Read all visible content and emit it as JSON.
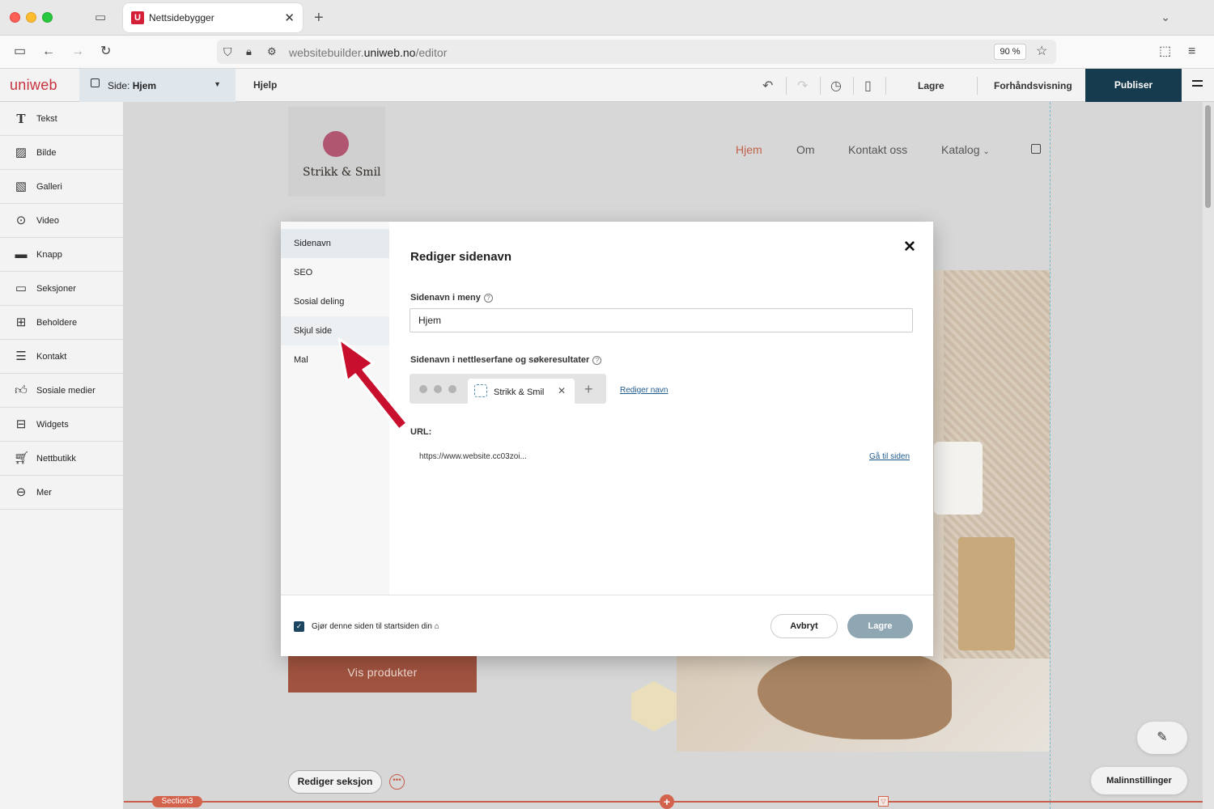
{
  "browser": {
    "tab_title": "Nettsidebygger",
    "tab_favicon": "U",
    "url_prefix": "websitebuilder.",
    "url_domain": "uniweb.no",
    "url_path": "/editor",
    "zoom": "90 %"
  },
  "editor": {
    "logo": "uniweb",
    "page_label": "Side:",
    "page_name": "Hjem",
    "help": "Hjelp",
    "save": "Lagre",
    "preview": "Forhåndsvisning",
    "publish": "Publiser",
    "publish_color": "#163a4e"
  },
  "sidebar": {
    "items": [
      {
        "label": "Tekst",
        "icon": "text-icon"
      },
      {
        "label": "Bilde",
        "icon": "image-icon"
      },
      {
        "label": "Galleri",
        "icon": "gallery-icon"
      },
      {
        "label": "Video",
        "icon": "video-icon"
      },
      {
        "label": "Knapp",
        "icon": "button-icon"
      },
      {
        "label": "Seksjoner",
        "icon": "sections-icon"
      },
      {
        "label": "Beholdere",
        "icon": "containers-icon"
      },
      {
        "label": "Kontakt",
        "icon": "contact-icon"
      },
      {
        "label": "Sosiale medier",
        "icon": "thumbs-up-icon"
      },
      {
        "label": "Widgets",
        "icon": "widgets-icon"
      },
      {
        "label": "Nettbutikk",
        "icon": "cart-icon"
      },
      {
        "label": "Mer",
        "icon": "more-icon"
      }
    ]
  },
  "site": {
    "name": "Strikk & Smil",
    "nav": [
      "Hjem",
      "Om",
      "Kontakt oss",
      "Katalog"
    ],
    "nav_active_color": "#c0614c",
    "cta": "Vis produkter",
    "edit_section": "Rediger seksjon",
    "section_tag": "Section3",
    "template_settings": "Malinnstillinger"
  },
  "modal": {
    "tabs": [
      "Sidenavn",
      "SEO",
      "Sosial deling",
      "Skjul side",
      "Mal"
    ],
    "title": "Rediger sidenavn",
    "menu_name_label": "Sidenavn i meny",
    "menu_name_value": "Hjem",
    "browser_name_label": "Sidenavn i nettleserfane og søkeresultater",
    "preview_tab_name": "Strikk & Smil",
    "edit_name_link": "Rediger navn",
    "url_label": "URL:",
    "url_value": "https://www.website.cc03zoi...",
    "goto_link": "Gå til siden",
    "startpage_label": "Gjør denne siden til startsiden din",
    "cancel": "Avbryt",
    "save": "Lagre"
  }
}
